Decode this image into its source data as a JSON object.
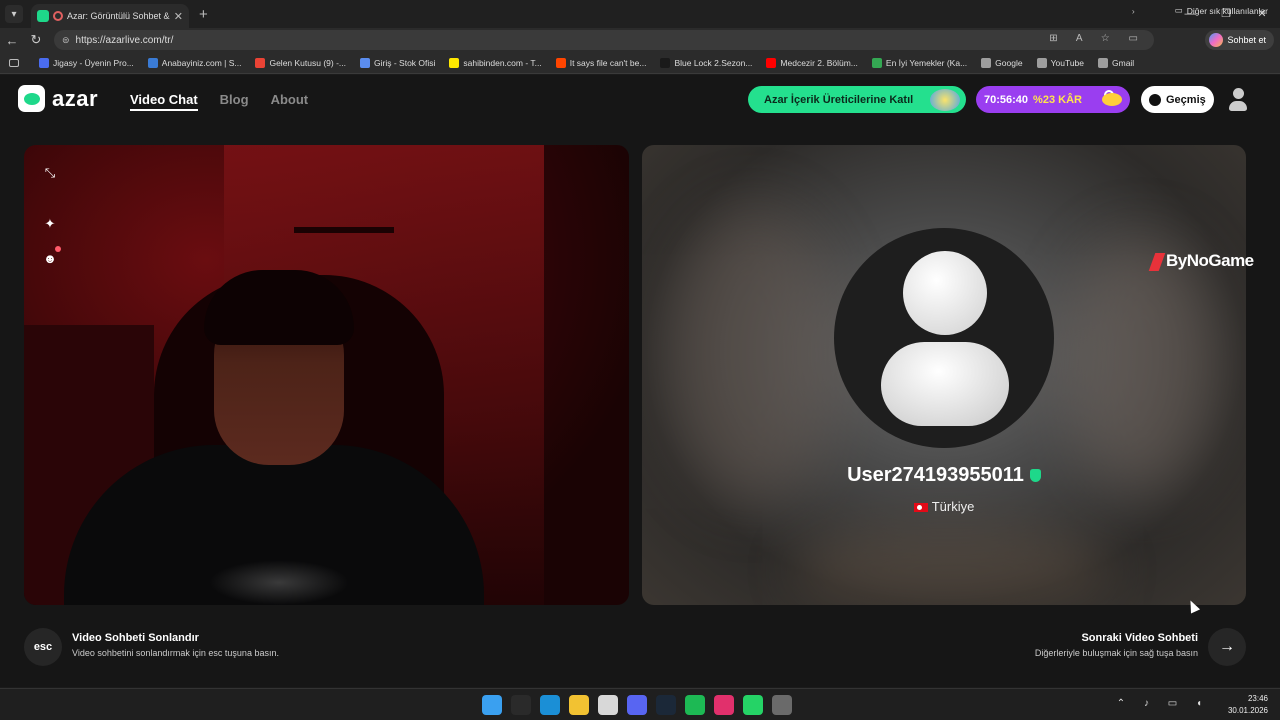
{
  "browser": {
    "tab_title": "Azar: Görüntülü Sohbet & Yer",
    "url": "https://azarlive.com/tr/",
    "copilot_label": "Sohbet et",
    "bookmarks": [
      {
        "label": "Jigasy - Üyenin Pro...",
        "color": "#4a6cf0"
      },
      {
        "label": "Anabayiniz.com | S...",
        "color": "#3a7bd5"
      },
      {
        "label": "Gelen Kutusu (9) -...",
        "color": "#ea4335"
      },
      {
        "label": "Giriş - Stok Ofisi",
        "color": "#5b8def"
      },
      {
        "label": "sahibinden.com - T...",
        "color": "#ffe800"
      },
      {
        "label": "It says file can't be...",
        "color": "#ff4500"
      },
      {
        "label": "Blue Lock 2.Sezon...",
        "color": "#1a1a1a"
      },
      {
        "label": "Medcezir 2. Bölüm...",
        "color": "#ff0000"
      },
      {
        "label": "En İyi Yemekler (Ka...",
        "color": "#34a853"
      },
      {
        "label": "Google",
        "color": "#9e9e9e"
      },
      {
        "label": "YouTube",
        "color": "#9e9e9e"
      },
      {
        "label": "Gmail",
        "color": "#9e9e9e"
      }
    ],
    "other_bookmarks": "Diğer sık kullanılanlar"
  },
  "site": {
    "logo_text": "azar",
    "nav": [
      "Video Chat",
      "Blog",
      "About"
    ],
    "creator_cta": "Azar İçerik Üreticilerine Katıl",
    "promo_timer": "70:56:40",
    "promo_discount": "%23 KÂR",
    "history_label": "Geçmiş"
  },
  "remote_user": {
    "username": "User27419395501​1",
    "country": "Türkiye"
  },
  "watermark": "ByNoGame",
  "actions": {
    "end_key": "esc",
    "end_title": "Video Sohbeti Sonlandır",
    "end_sub": "Video sohbetini sonlandırmak için esc tuşuna basın.",
    "next_title": "Sonraki Video Sohbeti",
    "next_sub": "Diğerleriyle buluşmak için sağ tuşa basın",
    "next_icon": "→"
  },
  "taskbar": {
    "time": "23:46",
    "date": "30.01.2026",
    "icons": [
      {
        "name": "windows-start-icon",
        "color": "#3aa0f0"
      },
      {
        "name": "search-icon",
        "color": "#2a2a2a"
      },
      {
        "name": "edge-icon",
        "color": "#1b8fd6"
      },
      {
        "name": "file-explorer-icon",
        "color": "#f2c232"
      },
      {
        "name": "store-icon",
        "color": "#d8d8d8"
      },
      {
        "name": "discord-icon",
        "color": "#5865f2"
      },
      {
        "name": "steam-icon",
        "color": "#1b2838"
      },
      {
        "name": "spotify-icon",
        "color": "#1db954"
      },
      {
        "name": "app-icon",
        "color": "#e1306c"
      },
      {
        "name": "whatsapp-icon",
        "color": "#25d366"
      },
      {
        "name": "settings-icon",
        "color": "#6a6a6a"
      }
    ]
  }
}
